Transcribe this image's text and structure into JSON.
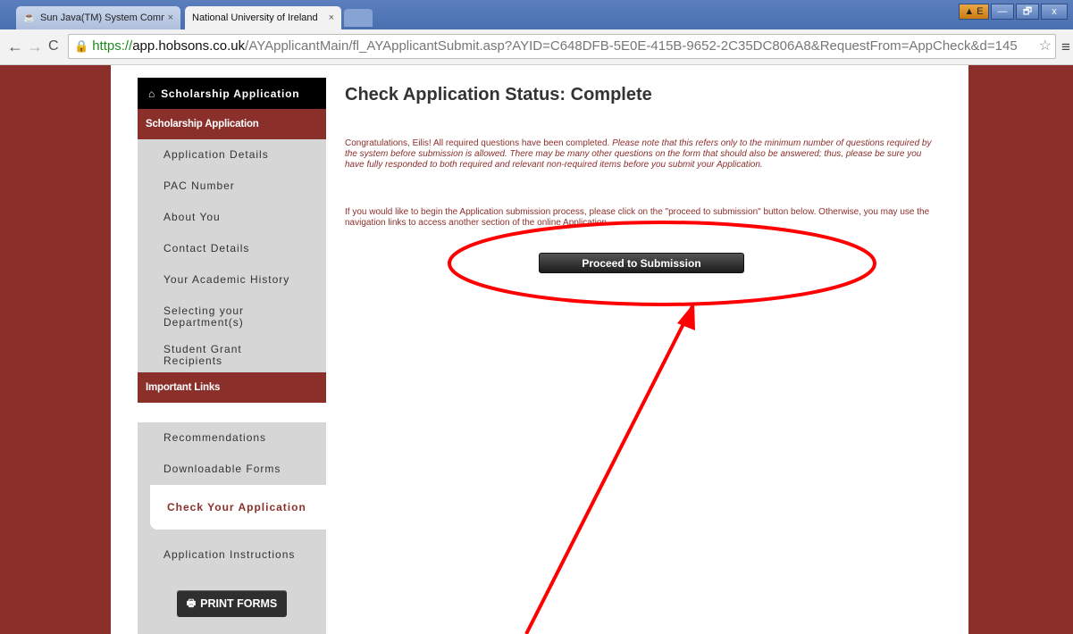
{
  "browser": {
    "tabs": [
      {
        "title": "Sun Java(TM) System Comm",
        "icon": "java-icon",
        "close": "×"
      },
      {
        "title": "National University of Ireland",
        "icon": "blank-page-icon",
        "close": "×"
      }
    ],
    "window_controls": {
      "warning_label": "▲ E",
      "minimize": "—",
      "maximize": "🗗",
      "close": "x"
    },
    "url": {
      "scheme": "https://",
      "host": "app.hobsons.co.uk",
      "path": "/AYApplicantMain/fl_AYApplicantSubmit.asp?AYID=C648DFB-5E0E-415B-9652-2C35DC806A8&RequestFrom=AppCheck&d=145"
    },
    "accent_color": "#4a6fb0"
  },
  "sidebar": {
    "header": "Scholarship Application",
    "sections": [
      {
        "title": "Scholarship Application",
        "items": [
          "Application Details",
          "PAC Number",
          "About You",
          "Contact Details",
          "Your Academic History",
          "Selecting your Department(s)",
          "Student Grant Recipients"
        ]
      },
      {
        "title": "Important Links",
        "items": [
          "Recommendations",
          "Downloadable Forms",
          "Check Your Application",
          "Application Instructions"
        ]
      }
    ],
    "print_button": "PRINT FORMS",
    "brand_color": "#8b2f2b"
  },
  "main": {
    "title": "Check Application Status: Complete",
    "para1_normal": "Congratulations, Eilis! All required questions have been completed. ",
    "para1_italic": "Please note that this refers only to the minimum number of questions required by the system before submission is allowed. There may be many other questions on the form that should also be answered; thus, please be sure you have fully responded to both required and relevant non-required items before you submit your Application.",
    "para2": "If you would like to begin the Application submission process, please click on the \"proceed to submission\" button below. Otherwise, you may use the navigation links to access another section of the online Application.",
    "proceed_button": "Proceed to Submission"
  },
  "annotation_color": "#ff0000"
}
